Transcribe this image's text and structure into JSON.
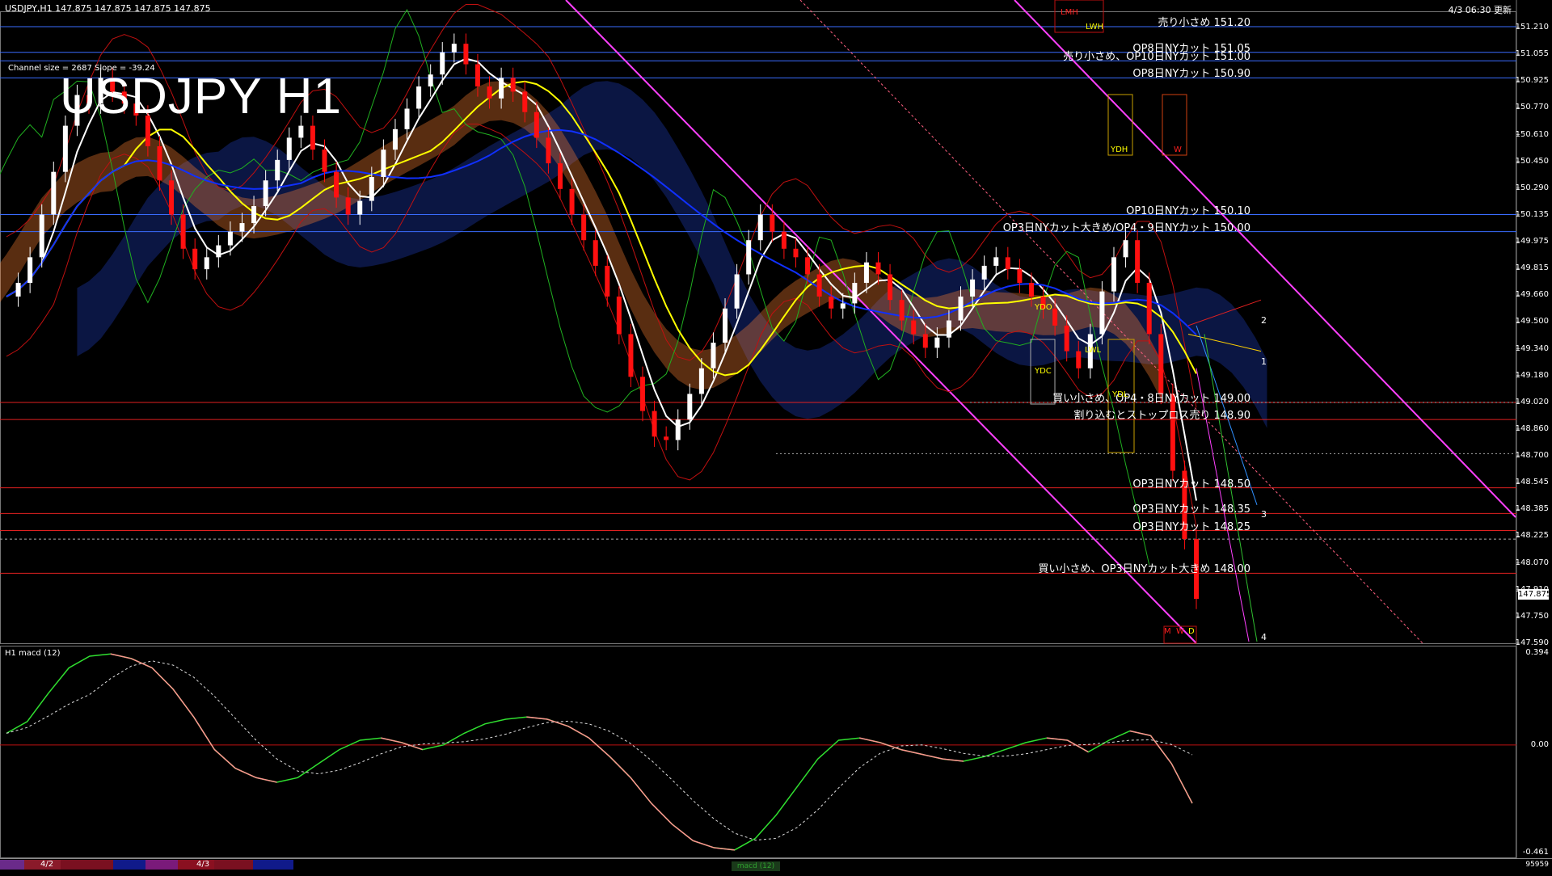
{
  "header": {
    "symbol_info": "USDJPY,H1  147.875 147.875 147.875 147.875",
    "datetime": "4/3 06:30 更新"
  },
  "title": "USDJPY H1",
  "channel_info": "Channel size = 2687 Slope = -39.24",
  "price_axis": [
    "151.210",
    "151.055",
    "150.925",
    "150.770",
    "150.610",
    "150.450",
    "150.290",
    "150.135",
    "149.975",
    "149.815",
    "149.660",
    "149.500",
    "149.340",
    "149.180",
    "149.020",
    "148.860",
    "148.700",
    "148.545",
    "148.385",
    "148.225",
    "148.070",
    "147.910",
    "147.750",
    "147.590"
  ],
  "current_price": "147.875",
  "levels": [
    {
      "label": "売り小さめ 151.20",
      "price": 151.2,
      "color": "#3a6cff"
    },
    {
      "label": "OP8日NYカット 151.05",
      "price": 151.05,
      "color": "#3a6cff"
    },
    {
      "label": "売り小さめ、OP10日NYカット 151.00",
      "price": 151.0,
      "color": "#3a6cff"
    },
    {
      "label": "OP8日NYカット 150.90",
      "price": 150.9,
      "color": "#3a6cff"
    },
    {
      "label": "OP10日NYカット 150.10",
      "price": 150.1,
      "color": "#3a6cff"
    },
    {
      "label": "OP3日NYカット大きめ/OP4・9日NYカット 150.00",
      "price": 150.0,
      "color": "#3a6cff"
    },
    {
      "label": "買い小さめ、OP4・8日NYカット 149.00",
      "price": 149.0,
      "color": "#e02020"
    },
    {
      "label": "割り込むとストップロス売り 148.90",
      "price": 148.9,
      "color": "#e02020"
    },
    {
      "label": "OP3日NYカット 148.50",
      "price": 148.5,
      "color": "#e02020"
    },
    {
      "label": "OP3日NYカット 148.35",
      "price": 148.35,
      "color": "#e02020"
    },
    {
      "label": "OP3日NYカット 148.25",
      "price": 148.25,
      "color": "#e02020"
    },
    {
      "label": "買い小さめ、OP3日NYカット大きめ 148.00",
      "price": 148.0,
      "color": "#e02020"
    }
  ],
  "box_labels": [
    "LMH",
    "LWH",
    "YDH",
    "W",
    "YDO",
    "YDC",
    "LWL",
    "YDL",
    "M",
    "W",
    "D"
  ],
  "wave_labels": [
    "1",
    "2",
    "3",
    "4"
  ],
  "macd": {
    "label": "H1  macd (12)",
    "axis": [
      "0.394",
      "0.00",
      "-0.461"
    ]
  },
  "bottom": {
    "days": [
      "4/2",
      "4/3"
    ],
    "scroll_label": "macd (12)",
    "right_value": "95959"
  },
  "colors": {
    "background": "#000000",
    "bull": "#ffffff",
    "bear": "#ff1010",
    "sma_short": "#ffffff",
    "sma_mid": "#ffff00",
    "sma_long": "#1030ff",
    "kumo_blue": "#2040c0",
    "kumo_orange": "#ff8030",
    "macd_up": "#30e030",
    "macd_down": "#ff9090",
    "channel": "#ff40ff"
  },
  "chart_data": {
    "type": "candlestick",
    "title": "USDJPY H1",
    "ylim": [
      147.59,
      151.29
    ],
    "close_path": [
      149.62,
      149.7,
      149.85,
      150.1,
      150.35,
      150.62,
      150.8,
      150.75,
      150.9,
      150.82,
      150.75,
      150.68,
      150.5,
      150.3,
      150.1,
      149.9,
      149.78,
      149.85,
      149.92,
      150.0,
      150.05,
      150.15,
      150.3,
      150.42,
      150.55,
      150.62,
      150.48,
      150.35,
      150.2,
      150.1,
      150.18,
      150.32,
      150.48,
      150.6,
      150.72,
      150.85,
      150.92,
      151.05,
      151.1,
      150.98,
      150.85,
      150.78,
      150.9,
      150.82,
      150.7,
      150.55,
      150.4,
      150.25,
      150.1,
      149.95,
      149.8,
      149.62,
      149.4,
      149.15,
      148.95,
      148.8,
      148.78,
      148.9,
      149.05,
      149.2,
      149.35,
      149.55,
      149.75,
      149.95,
      150.1,
      150.0,
      149.9,
      149.85,
      149.75,
      149.62,
      149.55,
      149.58,
      149.7,
      149.82,
      149.75,
      149.6,
      149.48,
      149.4,
      149.32,
      149.38,
      149.48,
      149.62,
      149.72,
      149.8,
      149.85,
      149.78,
      149.7,
      149.62,
      149.55,
      149.45,
      149.3,
      149.2,
      149.4,
      149.65,
      149.85,
      149.95,
      149.7,
      149.4,
      149.05,
      148.6,
      148.2,
      147.85
    ],
    "macd_path": [
      0.05,
      0.1,
      0.22,
      0.33,
      0.38,
      0.39,
      0.37,
      0.33,
      0.24,
      0.12,
      -0.02,
      -0.1,
      -0.14,
      -0.16,
      -0.14,
      -0.08,
      -0.02,
      0.02,
      0.03,
      0.01,
      -0.02,
      0.0,
      0.05,
      0.09,
      0.11,
      0.12,
      0.11,
      0.08,
      0.03,
      -0.05,
      -0.14,
      -0.25,
      -0.34,
      -0.41,
      -0.44,
      -0.45,
      -0.4,
      -0.3,
      -0.18,
      -0.06,
      0.02,
      0.03,
      0.01,
      -0.02,
      -0.04,
      -0.06,
      -0.07,
      -0.05,
      -0.02,
      0.01,
      0.03,
      0.02,
      -0.03,
      0.02,
      0.06,
      0.04,
      -0.08,
      -0.25
    ]
  }
}
